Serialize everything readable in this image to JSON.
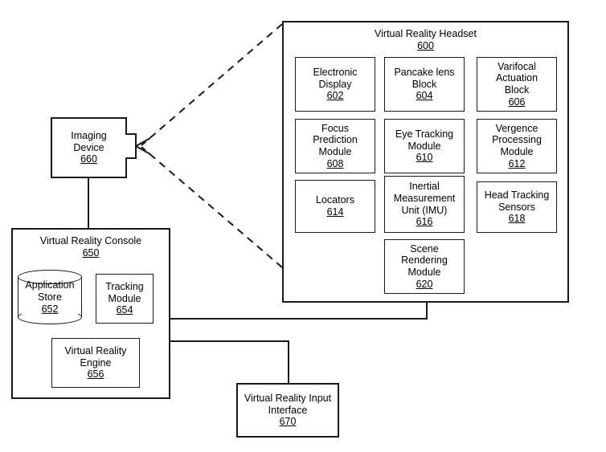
{
  "figure": {
    "headset": {
      "title": "Virtual Reality Headset",
      "ref": "600",
      "modules": [
        {
          "name": "electronic-display",
          "lines": [
            "Electronic",
            "Display"
          ],
          "ref": "602"
        },
        {
          "name": "pancake-lens-block",
          "lines": [
            "Pancake lens",
            "Block"
          ],
          "ref": "604"
        },
        {
          "name": "varifocal-actuation-block",
          "lines": [
            "Varifocal",
            "Actuation",
            "Block"
          ],
          "ref": "606"
        },
        {
          "name": "focus-prediction-module",
          "lines": [
            "Focus",
            "Prediction",
            "Module"
          ],
          "ref": "608"
        },
        {
          "name": "eye-tracking-module",
          "lines": [
            "Eye Tracking",
            "Module"
          ],
          "ref": "610"
        },
        {
          "name": "vergence-processing-module",
          "lines": [
            "Vergence",
            "Processing",
            "Module"
          ],
          "ref": "612"
        },
        {
          "name": "locators",
          "lines": [
            "Locators"
          ],
          "ref": "614"
        },
        {
          "name": "inertial-measurement-unit",
          "lines": [
            "Inertial",
            "Measurement",
            "Unit (IMU)"
          ],
          "ref": "616"
        },
        {
          "name": "head-tracking-sensors",
          "lines": [
            "Head Tracking",
            "Sensors"
          ],
          "ref": "618"
        },
        {
          "name": "scene-rendering-module",
          "lines": [
            "Scene",
            "Rendering",
            "Module"
          ],
          "ref": "620"
        }
      ]
    },
    "imaging_device": {
      "lines": [
        "Imaging",
        "Device"
      ],
      "ref": "660"
    },
    "console": {
      "title": "Virtual Reality Console",
      "ref": "650",
      "application_store": {
        "lines": [
          "Application",
          "Store"
        ],
        "ref": "652"
      },
      "tracking_module": {
        "lines": [
          "Tracking",
          "Module"
        ],
        "ref": "654"
      },
      "vr_engine": {
        "lines": [
          "Virtual Reality",
          "Engine"
        ],
        "ref": "656"
      }
    },
    "input_interface": {
      "lines": [
        "Virtual Reality Input",
        "Interface"
      ],
      "ref": "670"
    },
    "colors": {
      "line": "#1a1a1a",
      "background": "#ffffff",
      "text": "#000000"
    }
  }
}
